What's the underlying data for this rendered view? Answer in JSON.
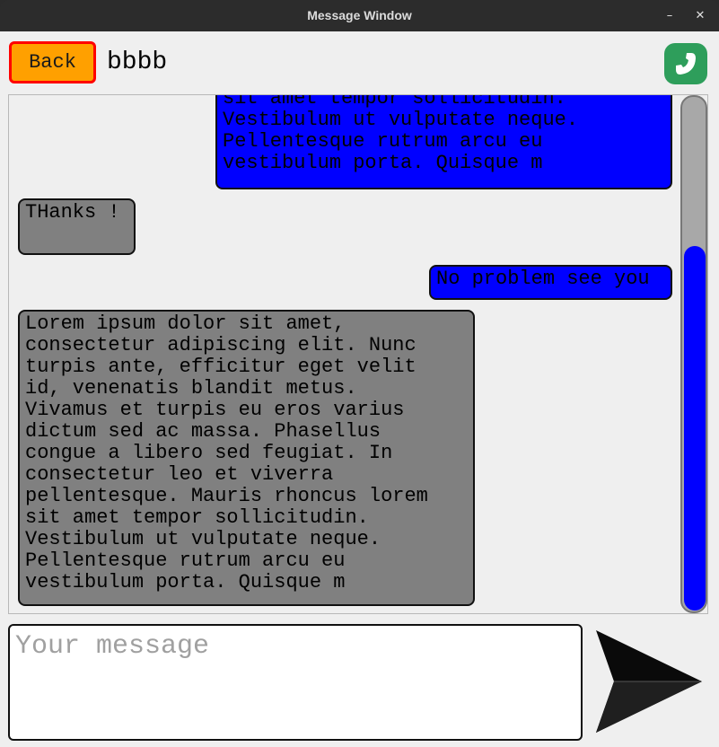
{
  "window": {
    "title": "Message Window",
    "minimize_glyph": "–",
    "close_glyph": "✕"
  },
  "header": {
    "back_label": "Back",
    "contact_name": "bbbb",
    "call_icon": "phone-icon"
  },
  "messages": [
    {
      "from": "me",
      "text": "sit amet tempor sollicitudin.\nVestibulum ut vulputate neque.\nPellentesque rutrum arcu eu\nvestibulum porta. Quisque m"
    },
    {
      "from": "them",
      "text": "THanks !"
    },
    {
      "from": "me",
      "text": "No problem see you"
    },
    {
      "from": "them",
      "text": "Lorem ipsum dolor sit amet,\nconsectetur adipiscing elit. Nunc\nturpis ante, efficitur eget velit\nid, venenatis blandit metus.\nVivamus et turpis eu eros varius\ndictum sed ac massa. Phasellus\ncongue a libero sed feugiat. In\nconsectetur leo et viverra\npellentesque. Mauris rhoncus lorem\nsit amet tempor sollicitudin.\nVestibulum ut vulputate neque.\nPellentesque rutrum arcu eu\nvestibulum porta. Quisque m"
    }
  ],
  "scrollbar": {
    "position_fraction": 1.0
  },
  "composer": {
    "placeholder": "Your message",
    "value": "",
    "send_icon": "send-arrow-icon"
  },
  "colors": {
    "back_bg": "#ffa000",
    "back_border": "#ff0000",
    "sent_bubble": "#0000ff",
    "received_bubble": "#808080",
    "call_bg": "#2e9e5b",
    "scroll_thumb": "#0000ff"
  }
}
